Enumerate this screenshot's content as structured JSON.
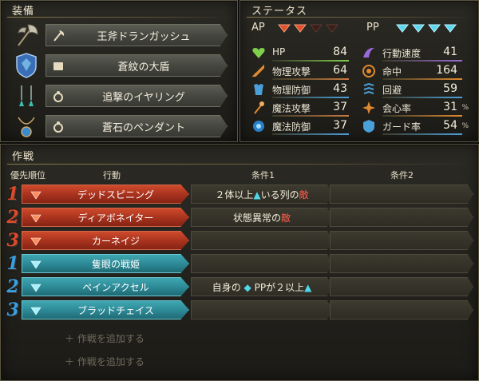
{
  "equipment": {
    "title": "装備",
    "items": [
      {
        "name": "王斧ドランガッシュ",
        "icon": "axe-icon",
        "type_icon": "axe-type-icon"
      },
      {
        "name": "蒼紋の大盾",
        "icon": "shield-icon",
        "type_icon": "shield-type-icon"
      },
      {
        "name": "追撃のイヤリング",
        "icon": "earring-icon",
        "type_icon": "ring-type-icon"
      },
      {
        "name": "蒼石のペンダント",
        "icon": "pendant-icon",
        "type_icon": "ring-type-icon"
      }
    ]
  },
  "status": {
    "title": "ステータス",
    "ap_label": "AP",
    "ap_filled": 2,
    "ap_total": 4,
    "pp_label": "PP",
    "pp_filled": 4,
    "pp_total": 4,
    "left": [
      {
        "label": "HP",
        "value": "84",
        "icon": "heart-icon",
        "bar_color": "#7fd04a"
      },
      {
        "label": "物理攻撃",
        "value": "64",
        "icon": "sword-icon",
        "bar_color": "#c87a40"
      },
      {
        "label": "物理防御",
        "value": "43",
        "icon": "armor-icon",
        "bar_color": "#4aa0d8"
      },
      {
        "label": "魔法攻撃",
        "value": "37",
        "icon": "staff-icon",
        "bar_color": "#c87a40"
      },
      {
        "label": "魔法防御",
        "value": "37",
        "icon": "magic-shield-icon",
        "bar_color": "#4aa0d8"
      }
    ],
    "right": [
      {
        "label": "行動速度",
        "value": "41",
        "unit": "",
        "icon": "speed-icon",
        "bar_color": "#9a6ad8"
      },
      {
        "label": "命中",
        "value": "164",
        "unit": "",
        "icon": "target-icon",
        "bar_color": "#e08a30"
      },
      {
        "label": "回避",
        "value": "59",
        "unit": "",
        "icon": "evade-icon",
        "bar_color": "#4aa0d8"
      },
      {
        "label": "会心率",
        "value": "31",
        "unit": "%",
        "icon": "critical-icon",
        "bar_color": "#e08a30"
      },
      {
        "label": "ガード率",
        "value": "54",
        "unit": "%",
        "icon": "guard-icon",
        "bar_color": "#4aa0d8"
      }
    ]
  },
  "tactics": {
    "title": "作戦",
    "headers": {
      "priority": "優先順位",
      "action": "行動",
      "cond1": "条件1",
      "cond2": "条件2"
    },
    "rows": [
      {
        "priority": "1",
        "kind": "ap",
        "action": "デッドスピニング",
        "cond1_parts": [
          {
            "t": "２体以上",
            "c": ""
          },
          {
            "t": "▲",
            "c": "cyan"
          },
          {
            "t": "いる列の",
            "c": ""
          },
          {
            "t": "敵",
            "c": "red"
          }
        ],
        "cond2": ""
      },
      {
        "priority": "2",
        "kind": "ap",
        "action": "ディアボネイター",
        "cond1_parts": [
          {
            "t": "状態異常の",
            "c": ""
          },
          {
            "t": "敵",
            "c": "red"
          }
        ],
        "cond2": ""
      },
      {
        "priority": "3",
        "kind": "ap",
        "action": "カーネイジ",
        "cond1_parts": [],
        "cond2": ""
      },
      {
        "priority": "1",
        "kind": "pp",
        "action": "隻眼の戦姫",
        "cond1_parts": [],
        "cond2": ""
      },
      {
        "priority": "2",
        "kind": "pp",
        "action": "ペインアクセル",
        "cond1_parts": [
          {
            "t": "自身の ",
            "c": ""
          },
          {
            "t": "◆",
            "c": "cyan"
          },
          {
            "t": " PPが２以上",
            "c": ""
          },
          {
            "t": "▲",
            "c": "cyan"
          }
        ],
        "cond2": ""
      },
      {
        "priority": "3",
        "kind": "pp",
        "action": "ブラッドチェイス",
        "cond1_parts": [],
        "cond2": ""
      }
    ],
    "add_label": "＋ 作戦を追加する"
  },
  "colors": {
    "ap_red": "#b8321e",
    "pp_teal": "#2f8f9a",
    "prio_ap": "#e04a2a",
    "prio_pp": "#3aa0e0"
  }
}
